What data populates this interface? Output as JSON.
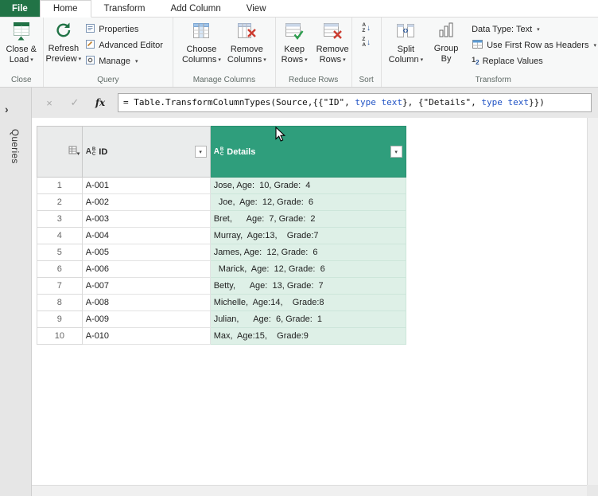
{
  "colors": {
    "file_tab_green": "#217346",
    "selected_column_header": "#2F9E7C",
    "selected_column_cell": "#DEF0E7",
    "formula_keyword_blue": "#2053C5"
  },
  "tabs": [
    {
      "label": "File"
    },
    {
      "label": "Home",
      "active": true
    },
    {
      "label": "Transform"
    },
    {
      "label": "Add Column"
    },
    {
      "label": "View"
    }
  ],
  "icons": {
    "dropdown": "▾",
    "expand_pane": "›",
    "discard": "×",
    "commit": "✓",
    "fx": "fx",
    "sort_arrow": "↓",
    "sort_a": "A",
    "sort_z": "Z",
    "replace_one": "1",
    "replace_two": "2"
  },
  "ribbon": {
    "groups": {
      "close": "Close",
      "query": "Query",
      "manage_columns": "Manage Columns",
      "reduce_rows": "Reduce Rows",
      "sort": "Sort",
      "transform": "Transform"
    },
    "close_load": {
      "line1": "Close &",
      "line2": "Load"
    },
    "refresh_preview": {
      "line1": "Refresh",
      "line2": "Preview"
    },
    "properties": "Properties",
    "advanced_editor": "Advanced Editor",
    "manage": "Manage",
    "choose_columns": {
      "line1": "Choose",
      "line2": "Columns"
    },
    "remove_columns": {
      "line1": "Remove",
      "line2": "Columns"
    },
    "keep_rows": {
      "line1": "Keep",
      "line2": "Rows"
    },
    "remove_rows": {
      "line1": "Remove",
      "line2": "Rows"
    },
    "split_column": {
      "line1": "Split",
      "line2": "Column"
    },
    "group_by": {
      "line1": "Group",
      "line2": "By"
    },
    "data_type": "Data Type: Text",
    "use_first_row": "Use First Row as Headers",
    "replace_values": "Replace Values"
  },
  "formula": {
    "p1": "= Table.TransformColumnTypes(Source,{{\"ID\", ",
    "k1": "type text",
    "p2": "}, {\"Details\", ",
    "k2": "type text",
    "p3": "}})"
  },
  "sidebar": {
    "label": "Queries"
  },
  "grid": {
    "columns": [
      {
        "name": "ID",
        "type": "text",
        "selected": false
      },
      {
        "name": "Details",
        "type": "text",
        "selected": true
      }
    ],
    "rows": [
      {
        "num": "1",
        "id": "A-001",
        "details": "Jose, Age:  10, Grade:  4"
      },
      {
        "num": "2",
        "id": "A-002",
        "details": "  Joe,  Age:  12, Grade:  6"
      },
      {
        "num": "3",
        "id": "A-003",
        "details": "Bret,      Age:  7, Grade:  2"
      },
      {
        "num": "4",
        "id": "A-004",
        "details": "Murray,  Age:13,    Grade:7"
      },
      {
        "num": "5",
        "id": "A-005",
        "details": "James, Age:  12, Grade:  6"
      },
      {
        "num": "6",
        "id": "A-006",
        "details": "  Marick,  Age:  12, Grade:  6"
      },
      {
        "num": "7",
        "id": "A-007",
        "details": "Betty,      Age:  13, Grade:  7"
      },
      {
        "num": "8",
        "id": "A-008",
        "details": "Michelle,  Age:14,    Grade:8"
      },
      {
        "num": "9",
        "id": "A-009",
        "details": "Julian,      Age:  6, Grade:  1"
      },
      {
        "num": "10",
        "id": "A-010",
        "details": "Max,  Age:15,    Grade:9"
      }
    ]
  }
}
